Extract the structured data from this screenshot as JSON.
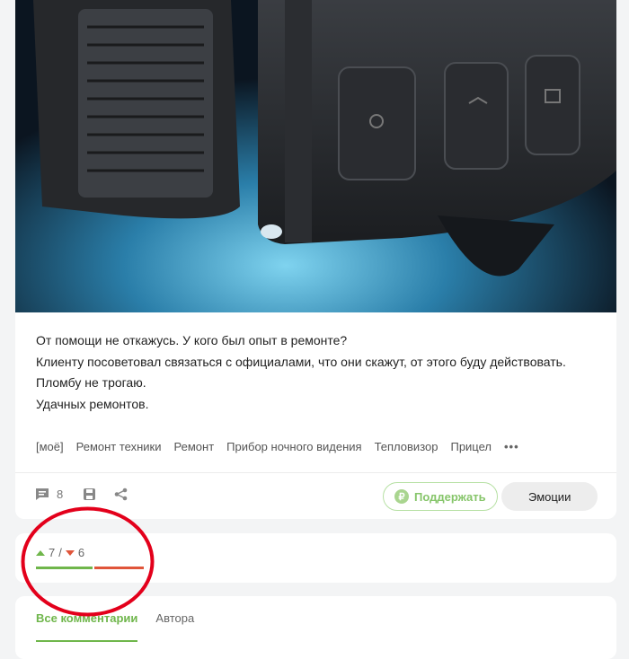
{
  "post": {
    "text_lines": [
      "От помощи не откажусь. У кого был опыт в ремонте?",
      "Клиенту посоветовал связаться с официалами, что они скажут, от этого буду действовать.",
      "Пломбу не трогаю.",
      "Удачных ремонтов."
    ],
    "tags": [
      "[моё]",
      "Ремонт техники",
      "Ремонт",
      "Прибор ночного видения",
      "Тепловизор",
      "Прицел"
    ],
    "more": "•••",
    "comments_count": "8",
    "support_label": "Поддержать",
    "emotions_label": "Эмоции"
  },
  "rating": {
    "up": "7",
    "separator": "/",
    "down": "6",
    "up_fraction": 0.538
  },
  "comments": {
    "tabs": [
      "Все комментарии",
      "Автора"
    ]
  },
  "colors": {
    "accent_green": "#6fb64b",
    "accent_red": "#e0553a",
    "annotation_red": "#e3001b"
  }
}
